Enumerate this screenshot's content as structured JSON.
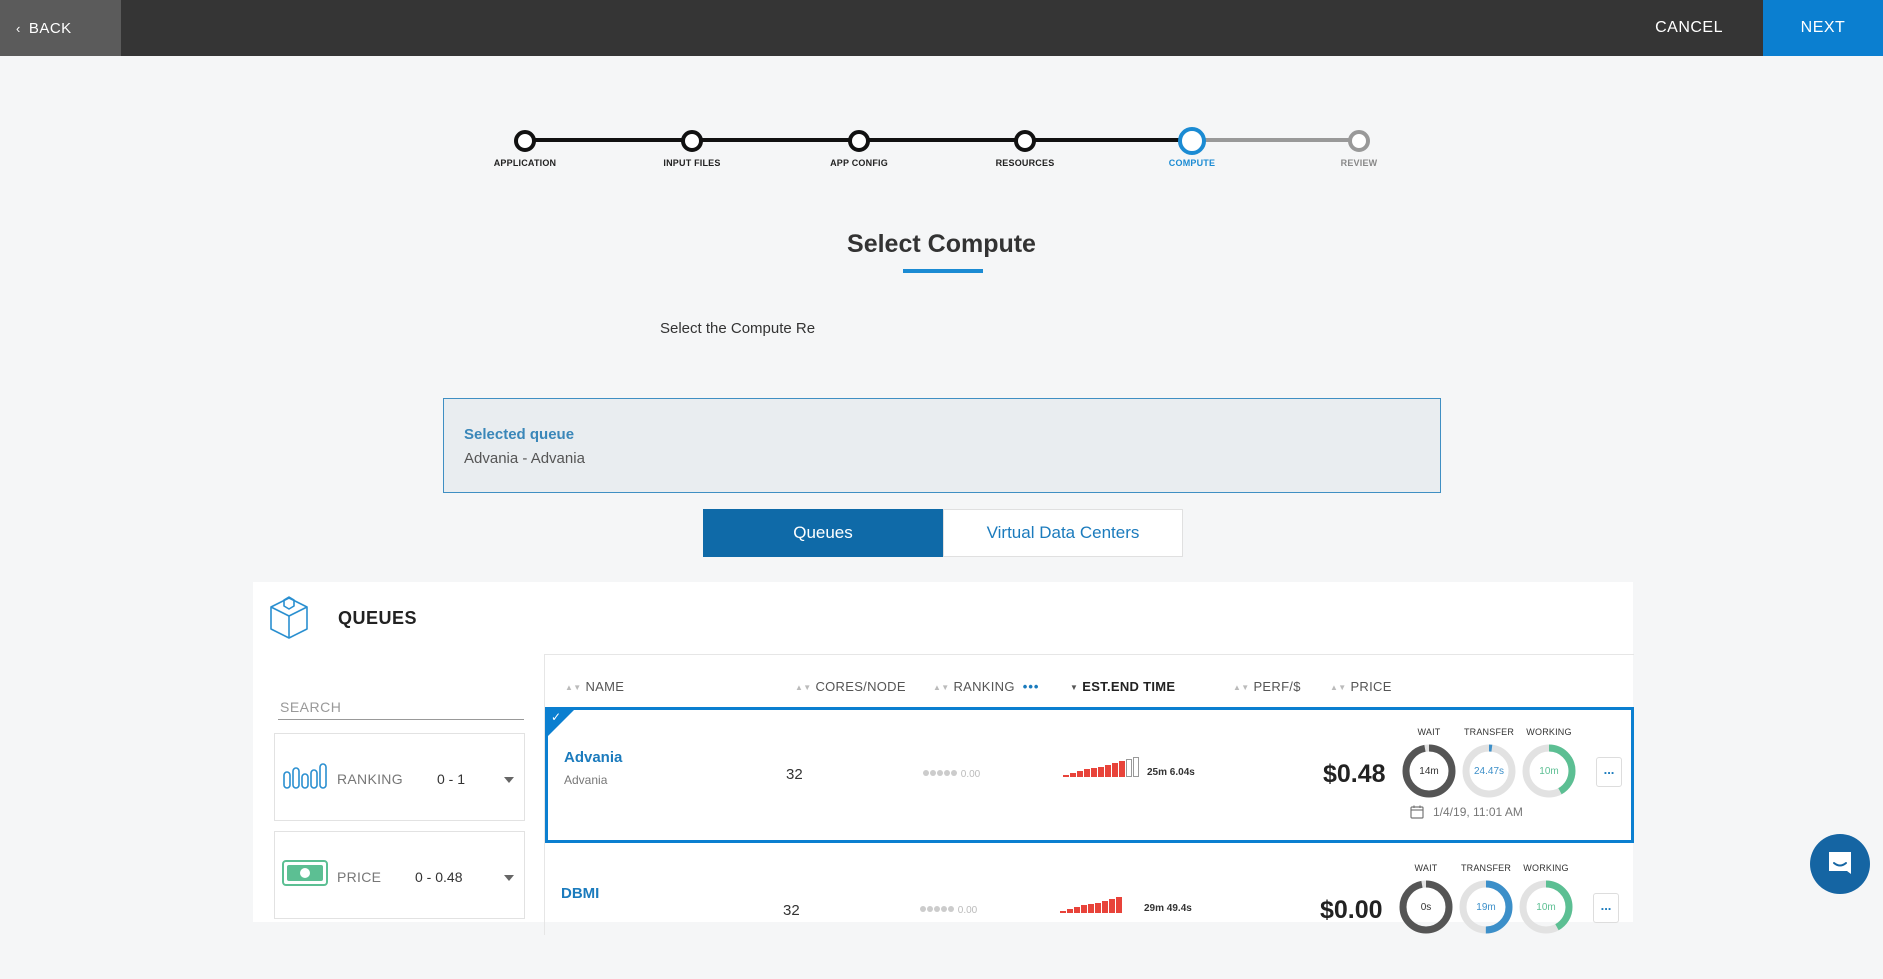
{
  "topbar": {
    "back_label": "BACK",
    "cancel_label": "CANCEL",
    "next_label": "NEXT"
  },
  "stepper": {
    "steps": [
      {
        "label": "APPLICATION",
        "state": "done"
      },
      {
        "label": "INPUT FILES",
        "state": "done"
      },
      {
        "label": "APP CONFIG",
        "state": "done"
      },
      {
        "label": "RESOURCES",
        "state": "done"
      },
      {
        "label": "COMPUTE",
        "state": "active"
      },
      {
        "label": "REVIEW",
        "state": "future"
      }
    ]
  },
  "page": {
    "title": "Select Compute",
    "intro": "Select the Compute Re"
  },
  "selected_queue": {
    "title": "Selected queue",
    "value": "Advania - Advania"
  },
  "tabs": {
    "queues": "Queues",
    "vdc": "Virtual Data Centers"
  },
  "panel": {
    "title": "QUEUES",
    "search_placeholder": "SEARCH",
    "filters": [
      {
        "label": "RANKING",
        "value": "0 - 1",
        "icon": "ranking-bars-icon"
      },
      {
        "label": "PRICE",
        "value": "0 - 0.48",
        "icon": "money-icon"
      }
    ]
  },
  "table": {
    "headers": {
      "name": "NAME",
      "cores": "CORES/NODE",
      "ranking": "RANKING",
      "ranking_more": "•••",
      "end_time": "EST.END TIME",
      "perf": "PERF/$",
      "price": "PRICE"
    },
    "ring_labels": {
      "wait": "WAIT",
      "transfer": "TRANSFER",
      "working": "WORKING"
    },
    "rows": [
      {
        "name": "Advania",
        "sub": "Advania",
        "cores": "32",
        "ranking": "0.00",
        "bars_filled": 9,
        "bars_empty": 2,
        "end_time": "25m 6.04s",
        "price": "$0.48",
        "wait": "14m",
        "wait_fill": 0.97,
        "transfer": "24.47s",
        "transfer_fill": 0.02,
        "working": "10m",
        "working_fill": 0.42,
        "date": "1/4/19, 11:01 AM",
        "more": "...",
        "selected": true
      },
      {
        "name": "DBMI",
        "sub": "",
        "cores": "32",
        "ranking": "0.00",
        "bars_filled": 9,
        "bars_empty": 0,
        "end_time": "29m 49.4s",
        "price": "$0.00",
        "wait": "0s",
        "wait_fill": 0.97,
        "transfer": "19m",
        "transfer_fill": 0.5,
        "working": "10m",
        "working_fill": 0.42,
        "date": "",
        "more": "...",
        "selected": false
      }
    ]
  },
  "colors": {
    "accent": "#0b7fd0",
    "danger_bars": "#e8433a",
    "working": "#5cbf93",
    "transfer": "#3c8fc9"
  }
}
